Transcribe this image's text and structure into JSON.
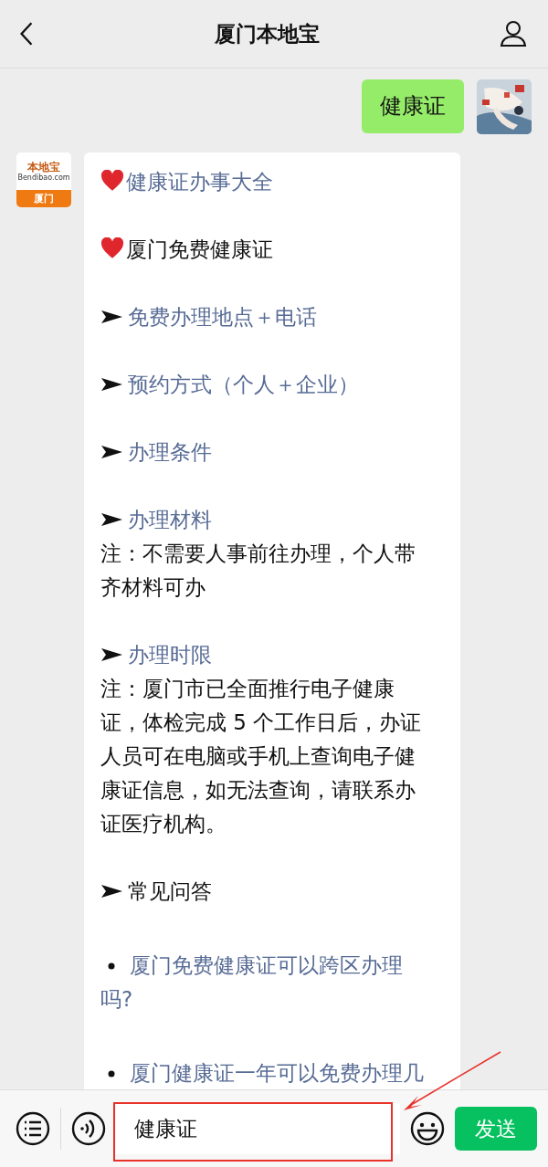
{
  "header": {
    "title": "厦门本地宝"
  },
  "messages": [
    {
      "kind": "outgoing",
      "text": "健康证"
    },
    {
      "kind": "incoming",
      "avatar": {
        "brand": "本地宝",
        "site": "Bendibao.com",
        "city": "厦门"
      },
      "lines": [
        {
          "kind": "heart",
          "text": "健康证办事大全",
          "link": true
        },
        {
          "kind": "heart",
          "text": "厦门免费健康证",
          "link": false
        },
        {
          "kind": "arrow",
          "text": "免费办理地点＋电话",
          "link": true
        },
        {
          "kind": "arrow",
          "text": "预约方式（个人＋企业）",
          "link": true
        },
        {
          "kind": "arrow",
          "text": "办理条件",
          "link": true
        },
        {
          "kind": "arrow",
          "text": "办理材料",
          "link": true,
          "note": "注：不需要人事前往办理，个人带齐材料可办"
        },
        {
          "kind": "arrow",
          "text": "办理时限",
          "link": true,
          "note": "注：厦门市已全面推行电子健康证，体检完成 5 个工作日后，办证人员可在电脑或手机上查询电子健康证信息，如无法查询，请联系办证医疗机构。"
        },
        {
          "kind": "arrow",
          "text": "常见问答",
          "link": false
        },
        {
          "kind": "bullet",
          "text": "厦门免费健康证可以跨区办理吗?",
          "link": true
        },
        {
          "kind": "bullet",
          "text": "厦门健康证一年可以免费办理几",
          "link": true
        }
      ]
    }
  ],
  "composer": {
    "value": "健康证",
    "send": "发送"
  }
}
